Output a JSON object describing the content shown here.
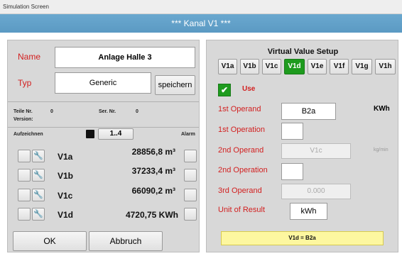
{
  "window": {
    "title": "Simulation Screen"
  },
  "header": {
    "title": "*** Kanal V1 ***"
  },
  "left": {
    "name_label": "Name",
    "name_value": "Anlage Halle 3",
    "typ_label": "Typ",
    "typ_value": "Generic",
    "save_label": "speichern",
    "teile_label": "Teile Nr.",
    "teile_value": "0",
    "ser_label": "Ser. Nr.",
    "ser_value": "0",
    "version_label": "Version:",
    "aufzeichnen_label": "Aufzeichnen",
    "page_label": "1..4",
    "alarm_label": "Alarm",
    "rows": [
      {
        "label": "V1a",
        "value": "28856,8 m³"
      },
      {
        "label": "V1b",
        "value": "37233,4 m³"
      },
      {
        "label": "V1c",
        "value": "66090,2 m³"
      },
      {
        "label": "V1d",
        "value": "4720,75 KWh"
      }
    ],
    "ok_label": "OK",
    "cancel_label": "Abbruch"
  },
  "right": {
    "title": "Virtual Value Setup",
    "channels": [
      "V1a",
      "V1b",
      "V1c",
      "V1d",
      "V1e",
      "V1f",
      "V1g",
      "V1h"
    ],
    "active_channel": "V1d",
    "use_label": "Use",
    "use_checked": true,
    "first_operand_label": "1st Operand",
    "first_operand_value": "B2a",
    "first_operand_unit": "KWh",
    "first_operation_label": "1st Operation",
    "first_operation_value": "",
    "second_operand_label": "2nd Operand",
    "second_operand_value": "V1c",
    "second_operand_unit": "kg/min",
    "second_operation_label": "2nd Operation",
    "second_operation_value": "",
    "third_operand_label": "3rd Operand",
    "third_operand_value": "0.000",
    "unit_label": "Unit of Result",
    "unit_value": "kWh",
    "formula": "V1d = B2a"
  },
  "colors": {
    "header": "#5b9ac3",
    "active_channel": "#1e9b1e",
    "label_red": "#d21f1f",
    "formula_bg": "#fdf7a0"
  }
}
